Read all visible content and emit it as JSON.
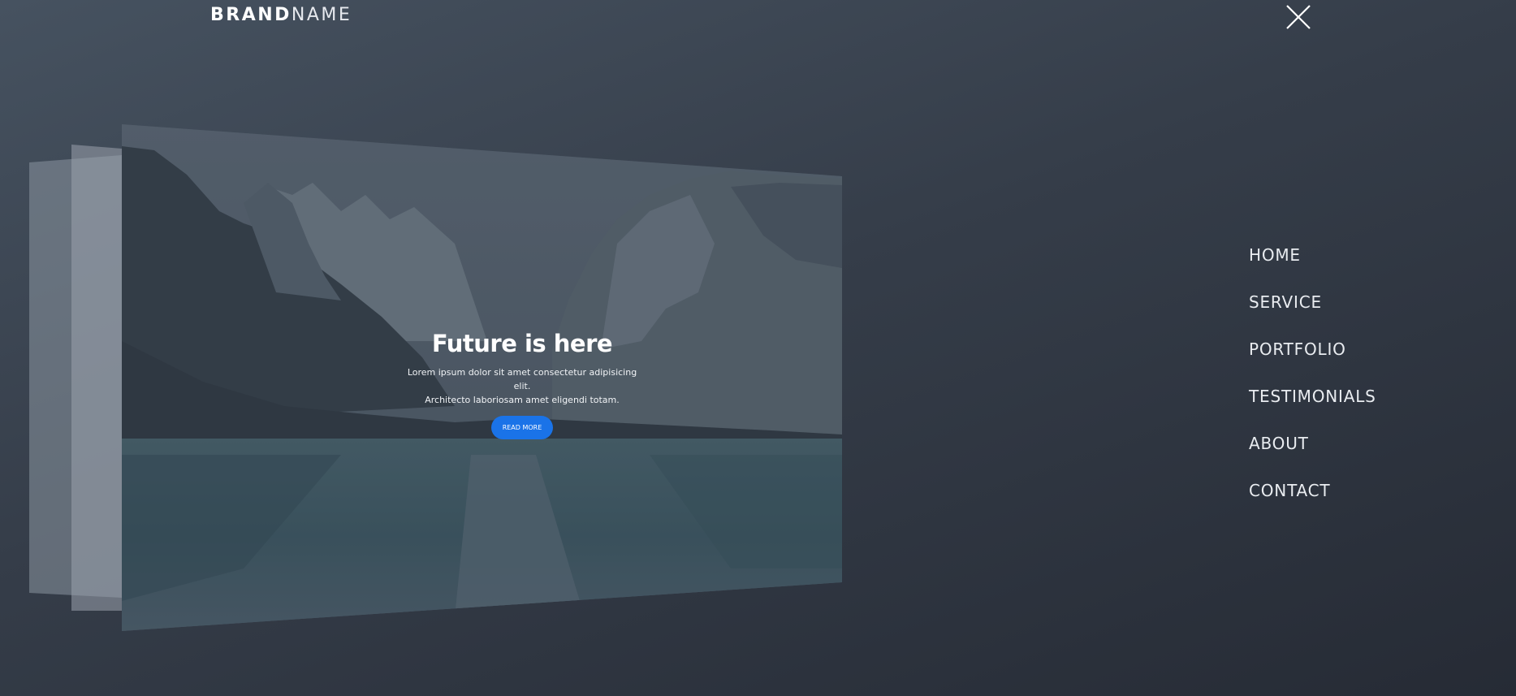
{
  "brand": {
    "bold": "BRAND",
    "light": "NAME"
  },
  "header": {
    "close_icon": "close-x-icon"
  },
  "hero": {
    "title": "Future is here",
    "desc_line1": "Lorem ipsum dolor sit amet consectetur adipisicing elit.",
    "desc_line2": "Architecto laboriosam amet eligendi totam.",
    "button_label": "READ MORE"
  },
  "menu": {
    "items": [
      {
        "label": "HOME"
      },
      {
        "label": "SERVICE"
      },
      {
        "label": "PORTFOLIO"
      },
      {
        "label": "TESTIMONIALS"
      },
      {
        "label": "ABOUT"
      },
      {
        "label": "CONTACT"
      }
    ]
  },
  "colors": {
    "accent": "#1a73e8",
    "background_top": "#465260",
    "background_bottom": "#262b35"
  }
}
